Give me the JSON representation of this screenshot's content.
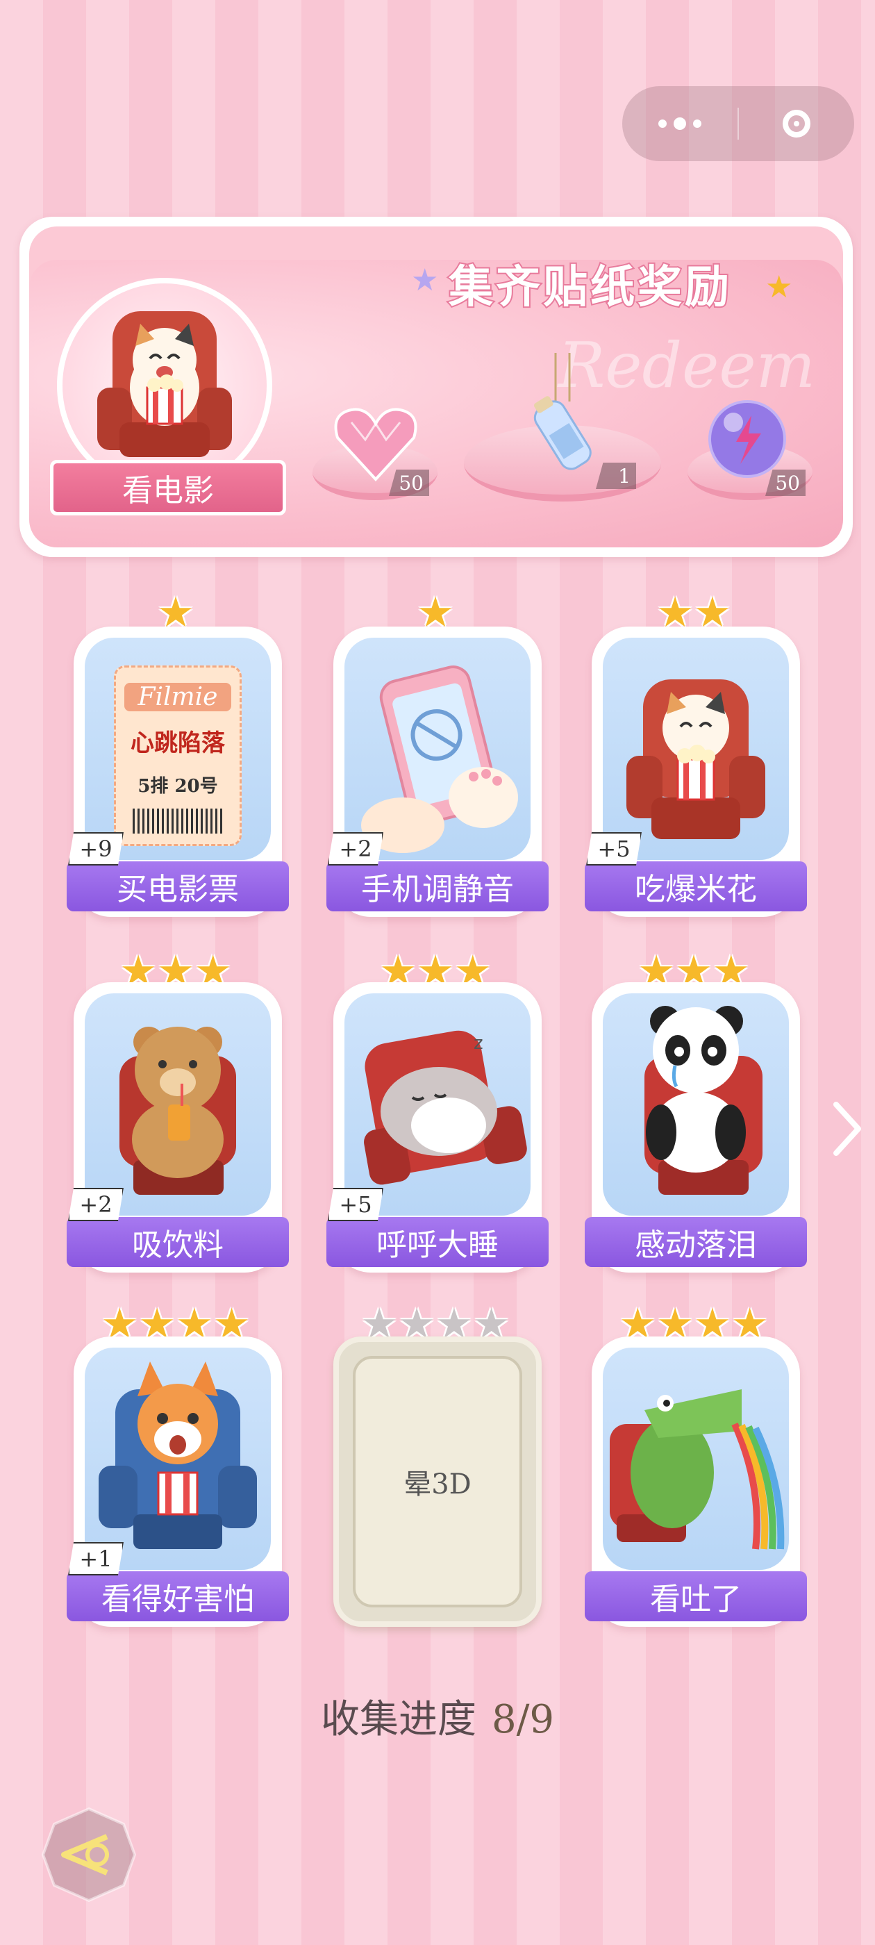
{
  "topbar": {
    "menu_icon": "more-dots-icon",
    "close_icon": "target-ring-icon"
  },
  "banner": {
    "title": "集齐贴纸奖励",
    "watermark": "Redeem",
    "activity_label": "看电影",
    "rewards": [
      {
        "name": "heart-gem",
        "count": "50"
      },
      {
        "name": "bottle-charm",
        "count": "1"
      },
      {
        "name": "energy-orb",
        "count": "50"
      }
    ]
  },
  "stickers": [
    {
      "label": "买电影票",
      "stars": 1,
      "bonus": "+9",
      "ticket": {
        "brand": "Filmie",
        "title": "心跳陷落",
        "seat": "5排 20号"
      }
    },
    {
      "label": "手机调静音",
      "stars": 1,
      "bonus": "+2"
    },
    {
      "label": "吃爆米花",
      "stars": 2,
      "bonus": "+5"
    },
    {
      "label": "吸饮料",
      "stars": 3,
      "bonus": "+2"
    },
    {
      "label": "呼呼大睡",
      "stars": 3,
      "bonus": "+5"
    },
    {
      "label": "感动落泪",
      "stars": 3,
      "bonus": ""
    },
    {
      "label": "看得好害怕",
      "stars": 4,
      "bonus": "+1"
    },
    {
      "label": "晕3D",
      "stars": 4,
      "bonus": "",
      "locked": true
    },
    {
      "label": "看吐了",
      "stars": 4,
      "bonus": ""
    }
  ],
  "progress": {
    "label": "收集进度",
    "value": "8/9"
  },
  "colors": {
    "accent_purple": "#9a66e8",
    "star_gold": "#f7b92a",
    "pink": "#f9c6d4"
  }
}
